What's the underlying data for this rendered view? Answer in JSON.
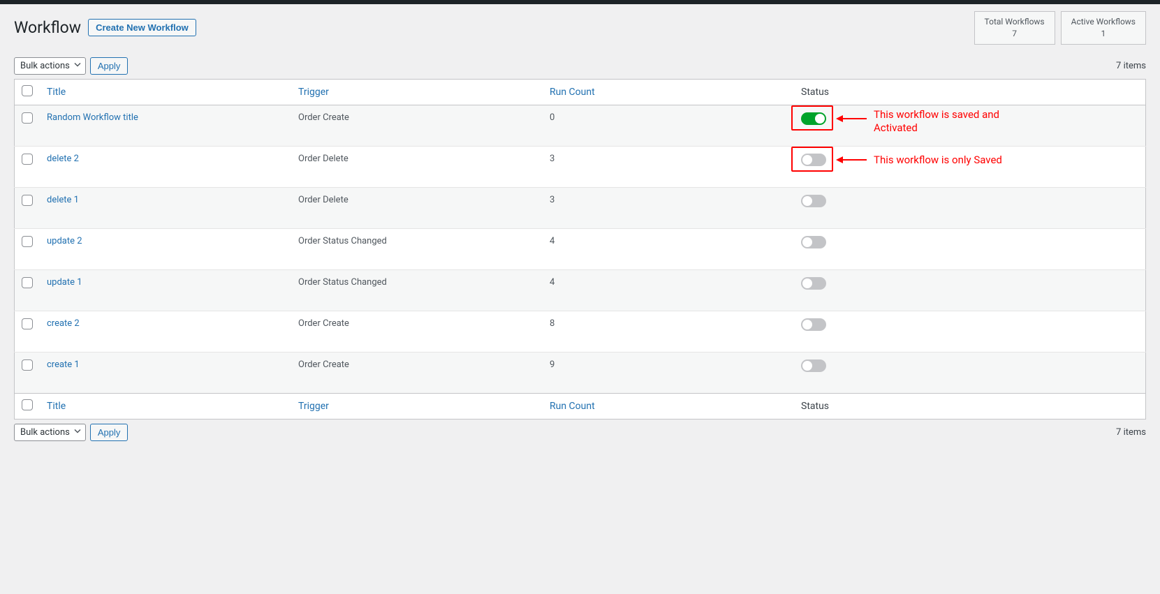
{
  "header": {
    "title": "Workflow",
    "create_button": "Create New Workflow"
  },
  "stats": [
    {
      "label": "Total Workflows",
      "value": "7"
    },
    {
      "label": "Active Workflows",
      "value": "1"
    }
  ],
  "bulk": {
    "label": "Bulk actions",
    "apply": "Apply"
  },
  "items_count_text": "7 items",
  "columns": {
    "title": "Title",
    "trigger": "Trigger",
    "run_count": "Run Count",
    "status": "Status"
  },
  "rows": [
    {
      "title": "Random Workflow title",
      "trigger": "Order Create",
      "run": "0",
      "active": true,
      "anno": "a"
    },
    {
      "title": "delete 2",
      "trigger": "Order Delete",
      "run": "3",
      "active": false,
      "anno": "b"
    },
    {
      "title": "delete 1",
      "trigger": "Order Delete",
      "run": "3",
      "active": false,
      "anno": null
    },
    {
      "title": "update 2",
      "trigger": "Order Status Changed",
      "run": "4",
      "active": false,
      "anno": null
    },
    {
      "title": "update 1",
      "trigger": "Order Status Changed",
      "run": "4",
      "active": false,
      "anno": null
    },
    {
      "title": "create 2",
      "trigger": "Order Create",
      "run": "8",
      "active": false,
      "anno": null
    },
    {
      "title": "create 1",
      "trigger": "Order Create",
      "run": "9",
      "active": false,
      "anno": null
    }
  ],
  "annotations": {
    "a": "This workflow is saved and\nActivated",
    "b": "This workflow is only Saved"
  }
}
